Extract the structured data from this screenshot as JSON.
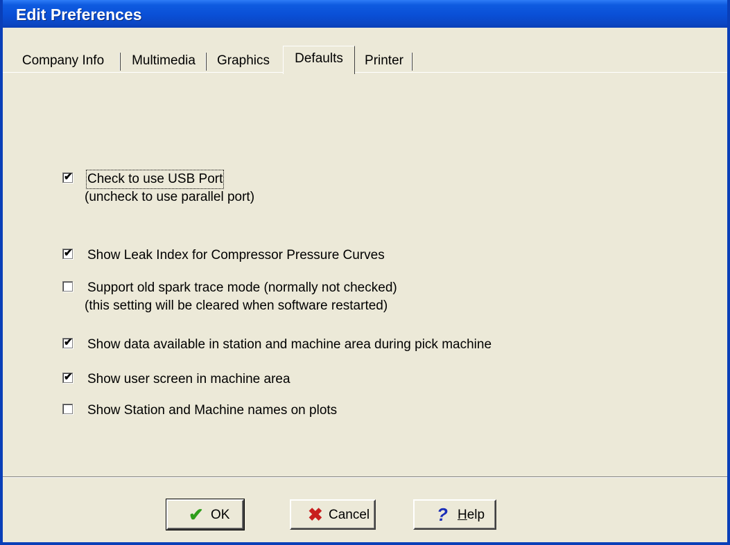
{
  "window": {
    "title": "Edit Preferences"
  },
  "tabs": [
    {
      "label": "Company Info"
    },
    {
      "label": "Multimedia"
    },
    {
      "label": "Graphics"
    },
    {
      "label": "Defaults",
      "active": true
    },
    {
      "label": "Printer"
    }
  ],
  "options": [
    {
      "label": "Check to use USB Port",
      "note": "(uncheck to use parallel port)",
      "checked": true
    },
    {
      "label": "Show Leak Index for Compressor Pressure Curves",
      "checked": true
    },
    {
      "label": "Support old spark trace mode (normally not checked)",
      "note": "(this setting will be cleared when software restarted)",
      "checked": false
    },
    {
      "label": "Show data available in station and machine area during pick machine",
      "checked": true
    },
    {
      "label": "Show user screen in machine area",
      "checked": true
    },
    {
      "label": "Show Station and Machine names on plots",
      "checked": false
    }
  ],
  "buttons": {
    "ok": {
      "label": "OK",
      "icon": "checkmark-icon"
    },
    "cancel": {
      "label": "Cancel",
      "icon": "x-icon"
    },
    "help": {
      "label_prefix": "H",
      "label_rest": "elp",
      "icon": "question-icon"
    }
  },
  "colors": {
    "title_bar": "#0A4FD6",
    "face": "#ECE9D8",
    "ok_icon": "#2E9E1A",
    "cancel_icon": "#C81E1E",
    "help_icon": "#1A2DB8"
  }
}
